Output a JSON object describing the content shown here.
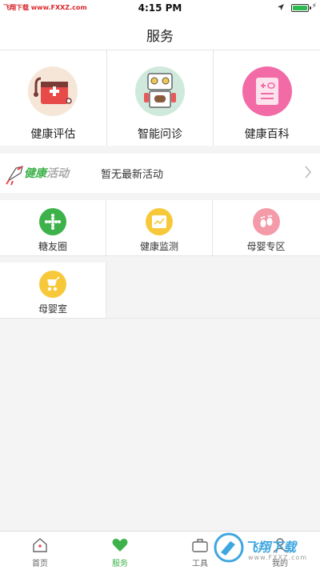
{
  "status_bar": {
    "carrier_watermark": "飞翔下载 www.FXXZ.com",
    "time": "4:15 PM",
    "battery_level": 1.0
  },
  "header": {
    "title": "服务"
  },
  "top_services": [
    {
      "label": "健康评估",
      "icon": "first-aid-kit-icon",
      "color": "#f6e6d8"
    },
    {
      "label": "智能问诊",
      "icon": "robot-icon",
      "color": "#cfeadc"
    },
    {
      "label": "健康百科",
      "icon": "pill-box-icon",
      "color": "#f26ba6"
    }
  ],
  "activity": {
    "logo_part1": "健康",
    "logo_part2": "活动",
    "text": "暂无最新活动"
  },
  "grid_services": [
    {
      "label": "糖友圈",
      "icon": "circle-dots-icon",
      "color": "#3db24b"
    },
    {
      "label": "健康监测",
      "icon": "monitor-chart-icon",
      "color": "#f7c93a"
    },
    {
      "label": "母婴专区",
      "icon": "baby-feet-icon",
      "color": "#f49aa8"
    },
    {
      "label": "母婴室",
      "icon": "stroller-icon",
      "color": "#f7c93a"
    }
  ],
  "tab_bar": {
    "items": [
      {
        "label": "首页",
        "icon": "home-icon"
      },
      {
        "label": "服务",
        "icon": "heart-icon"
      },
      {
        "label": "工具",
        "icon": "toolbox-icon"
      },
      {
        "label": "我的",
        "icon": "person-icon"
      }
    ],
    "active_index": 1
  },
  "bottom_watermark": {
    "text": "飞翔下载",
    "url": "www.FXXZ.com"
  },
  "colors": {
    "accent": "#3db24b",
    "background": "#f4f4f4"
  }
}
